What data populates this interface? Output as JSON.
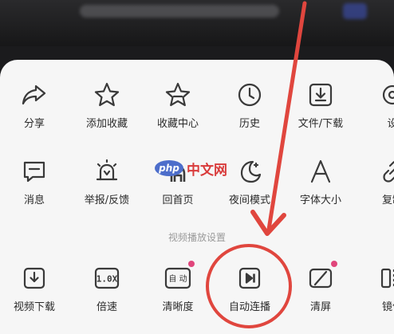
{
  "row1": [
    {
      "label": "分享",
      "icon": "share-icon"
    },
    {
      "label": "添加收藏",
      "icon": "star-icon"
    },
    {
      "label": "收藏中心",
      "icon": "star-badge-icon"
    },
    {
      "label": "历史",
      "icon": "clock-icon"
    },
    {
      "label": "文件/下载",
      "icon": "download-box-icon"
    },
    {
      "label": "设",
      "icon": "settings-icon"
    }
  ],
  "row2": [
    {
      "label": "消息",
      "icon": "message-icon"
    },
    {
      "label": "举报/反馈",
      "icon": "alarm-icon"
    },
    {
      "label": "回首页",
      "icon": "home-icon"
    },
    {
      "label": "夜间模式",
      "icon": "moon-icon"
    },
    {
      "label": "字体大小",
      "icon": "font-a-icon"
    },
    {
      "label": "复制",
      "icon": "link-icon"
    }
  ],
  "section_title": "视频播放设置",
  "row3": [
    {
      "label": "视频下载",
      "icon": "video-download-icon"
    },
    {
      "label": "倍速",
      "icon": "speed-icon",
      "icon_text": "1.0X"
    },
    {
      "label": "清晰度",
      "icon": "quality-icon",
      "icon_text": "自 动"
    },
    {
      "label": "自动连播",
      "icon": "autoplay-icon"
    },
    {
      "label": "清屏",
      "icon": "clear-screen-icon"
    },
    {
      "label": "镜像",
      "icon": "mirror-icon"
    }
  ],
  "watermark": {
    "logo": "php",
    "text": "中文网"
  },
  "colors": {
    "annotation": "#e0463e",
    "badge": "#e0457b",
    "icon": "#3a3a3a"
  }
}
